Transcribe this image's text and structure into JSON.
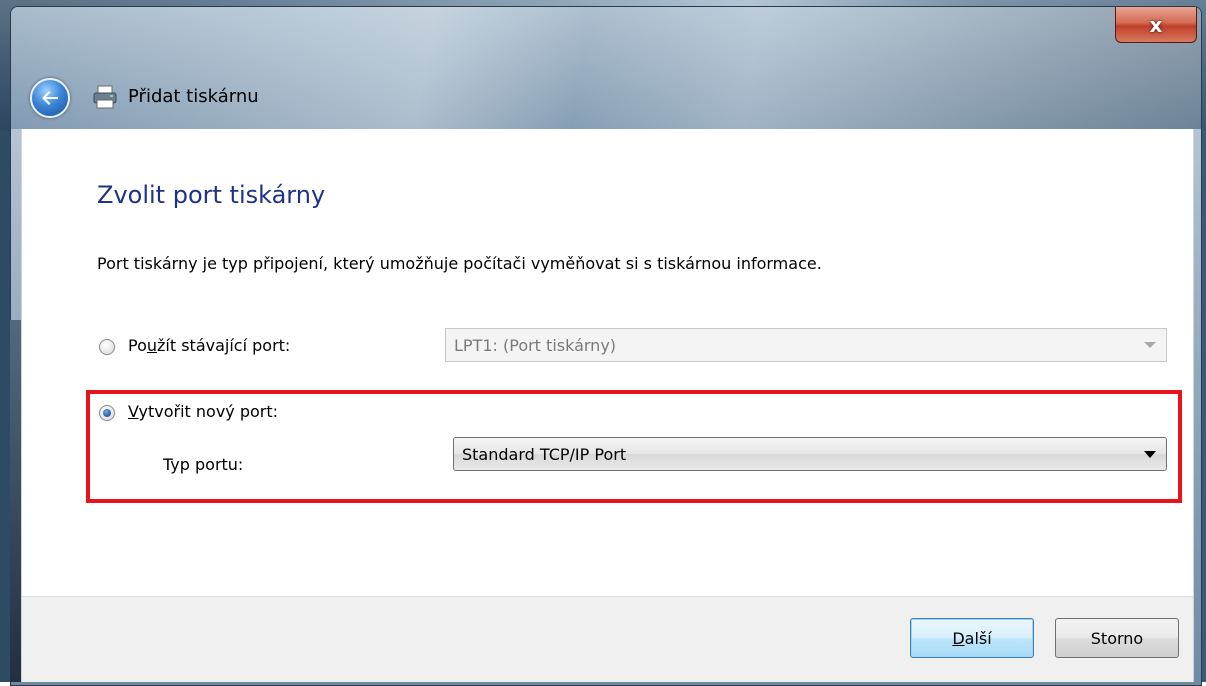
{
  "window": {
    "title": "Přidat tiskárnu",
    "close_label": "x"
  },
  "page": {
    "heading": "Zvolit port tiskárny",
    "description": "Port tiskárny je typ připojení, který umožňuje počítači vyměňovat si s tiskárnou informace."
  },
  "options": {
    "existing_port": {
      "label_before": "Po",
      "label_mnemonic": "u",
      "label_after": "žít stávající port:",
      "selected": false,
      "combo_value": "LPT1: (Port tiskárny)"
    },
    "new_port": {
      "label_mnemonic": "V",
      "label_after": "ytvořit nový port:",
      "selected": true,
      "type_label": "Typ portu:",
      "combo_value": "Standard TCP/IP Port"
    }
  },
  "footer": {
    "next_mnemonic": "D",
    "next_rest": "alší",
    "cancel_label": "Storno"
  },
  "colors": {
    "heading": "#1e3287",
    "highlight": "#e8141c"
  }
}
